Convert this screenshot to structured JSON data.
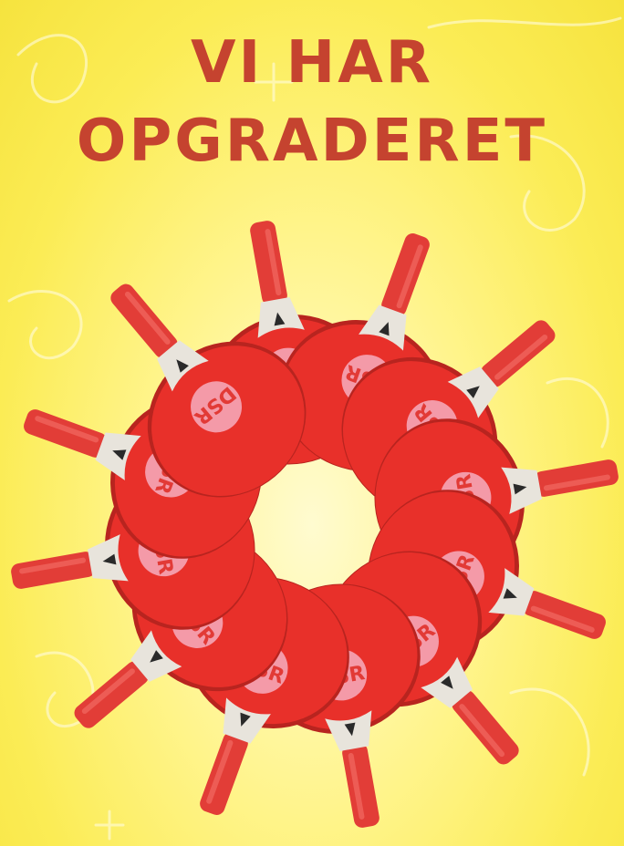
{
  "headline": {
    "line1": "VI HAR",
    "line2": "OPGRADERET"
  },
  "colors": {
    "background": "#f8e74a",
    "headline": "#c5432f",
    "paddle_rubber": "#e8302a",
    "paddle_logo_circle": "#f49aa8",
    "paddle_handle": "#e23d37",
    "paddle_throat": "#e8e4dc"
  },
  "paddles": {
    "count": 12,
    "logo_text": "DSR",
    "throat_mark_icon": "triangle-logo-icon"
  }
}
